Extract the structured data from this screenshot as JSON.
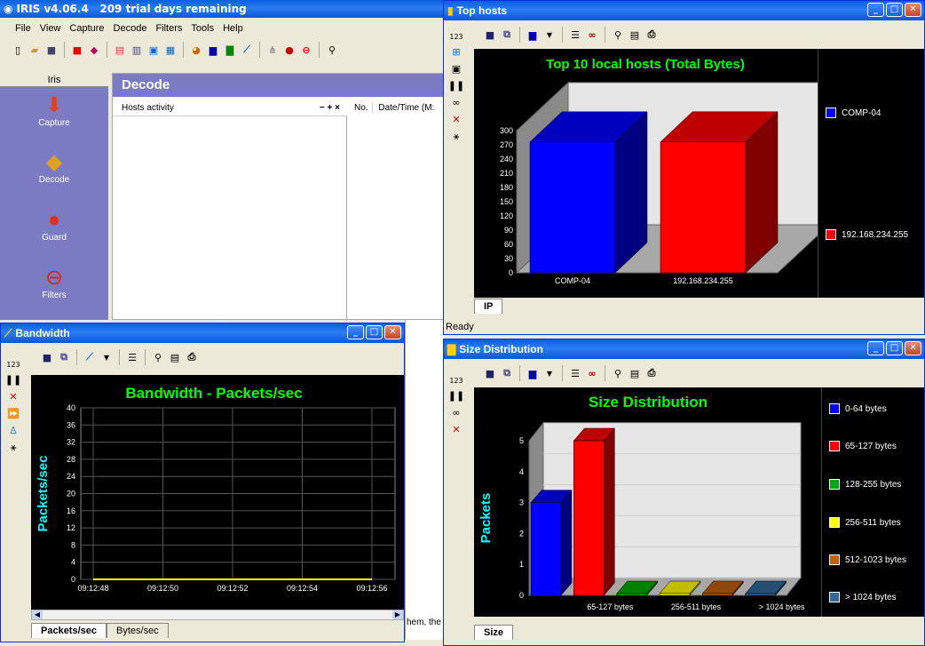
{
  "app": {
    "title": "IRIS v4.06.4   209 trial days remaining",
    "menu": [
      "File",
      "View",
      "Capture",
      "Decode",
      "Filters",
      "Tools",
      "Help"
    ],
    "sidebar_header": "Iris",
    "sidebar_items": [
      "Capture",
      "Decode",
      "Guard",
      "Filters"
    ],
    "decode_header": "Decode",
    "hosts_activity_label": "Hosts activity",
    "hosts_controls": "−  +  ×",
    "col_no": "No.",
    "col_datetime": "Date/Time (M:",
    "clipped_text": "hem, the"
  },
  "top_hosts": {
    "window_title": "Top hosts",
    "tool_123": "123",
    "tab": "IP",
    "status": "Ready",
    "legend": [
      {
        "label": "COMP-04",
        "color": "#0000ff"
      },
      {
        "label": "192.168.234.255",
        "color": "#ff0000"
      }
    ]
  },
  "bandwidth": {
    "window_title": "Bandwidth",
    "tool_123": "123",
    "tabs": [
      "Packets/sec",
      "Bytes/sec"
    ]
  },
  "size_dist": {
    "window_title": "Size Distribution",
    "tool_123": "123",
    "tab": "Size",
    "legend": [
      {
        "label": "0-64 bytes",
        "color": "#0000ff"
      },
      {
        "label": "65-127 bytes",
        "color": "#ff0000"
      },
      {
        "label": "128-255 bytes",
        "color": "#00aa00"
      },
      {
        "label": "256-511 bytes",
        "color": "#ffff00"
      },
      {
        "label": "512-1023 bytes",
        "color": "#c06010"
      },
      {
        "label": "> 1024 bytes",
        "color": "#336699"
      }
    ]
  },
  "chart_data": [
    {
      "type": "bar",
      "title": "Top 10  local hosts  (Total Bytes)",
      "categories": [
        "COMP-04",
        "192.168.234.255"
      ],
      "values": [
        276,
        276
      ],
      "colors": [
        "#0000ff",
        "#ff0000"
      ],
      "ylim": [
        0,
        300
      ],
      "yticks": [
        0,
        30,
        60,
        90,
        120,
        150,
        180,
        210,
        240,
        270,
        300
      ],
      "grid": false,
      "legend_position": "right"
    },
    {
      "type": "line",
      "title": "Bandwidth - Packets/sec",
      "ylabel": "Packets/sec",
      "x": [
        "09:12:48",
        "09:12:50",
        "09:12:52",
        "09:12:54",
        "09:12:56"
      ],
      "series": [
        {
          "values": [
            0,
            0,
            0,
            0,
            0
          ],
          "color": "#ffff00"
        }
      ],
      "ylim": [
        0,
        40
      ],
      "yticks": [
        0,
        4,
        8,
        12,
        16,
        20,
        24,
        28,
        32,
        36,
        40
      ],
      "grid": true
    },
    {
      "type": "bar",
      "title": "Size Distribution",
      "ylabel": "Packets",
      "categories": [
        "0-64 bytes",
        "65-127 bytes",
        "128-255 bytes",
        "256-511 bytes",
        "512-1023 bytes",
        "> 1024 bytes"
      ],
      "values": [
        3,
        5,
        0,
        0,
        0,
        0
      ],
      "colors": [
        "#0000ff",
        "#ff0000",
        "#00aa00",
        "#ffff00",
        "#c06010",
        "#336699"
      ],
      "xtick_labels": [
        "65-127 bytes",
        "256-511 bytes",
        "> 1024 bytes"
      ],
      "ylim": [
        0,
        5
      ],
      "yticks": [
        0,
        1,
        2,
        3,
        4,
        5
      ],
      "grid": true,
      "legend_position": "right"
    }
  ]
}
